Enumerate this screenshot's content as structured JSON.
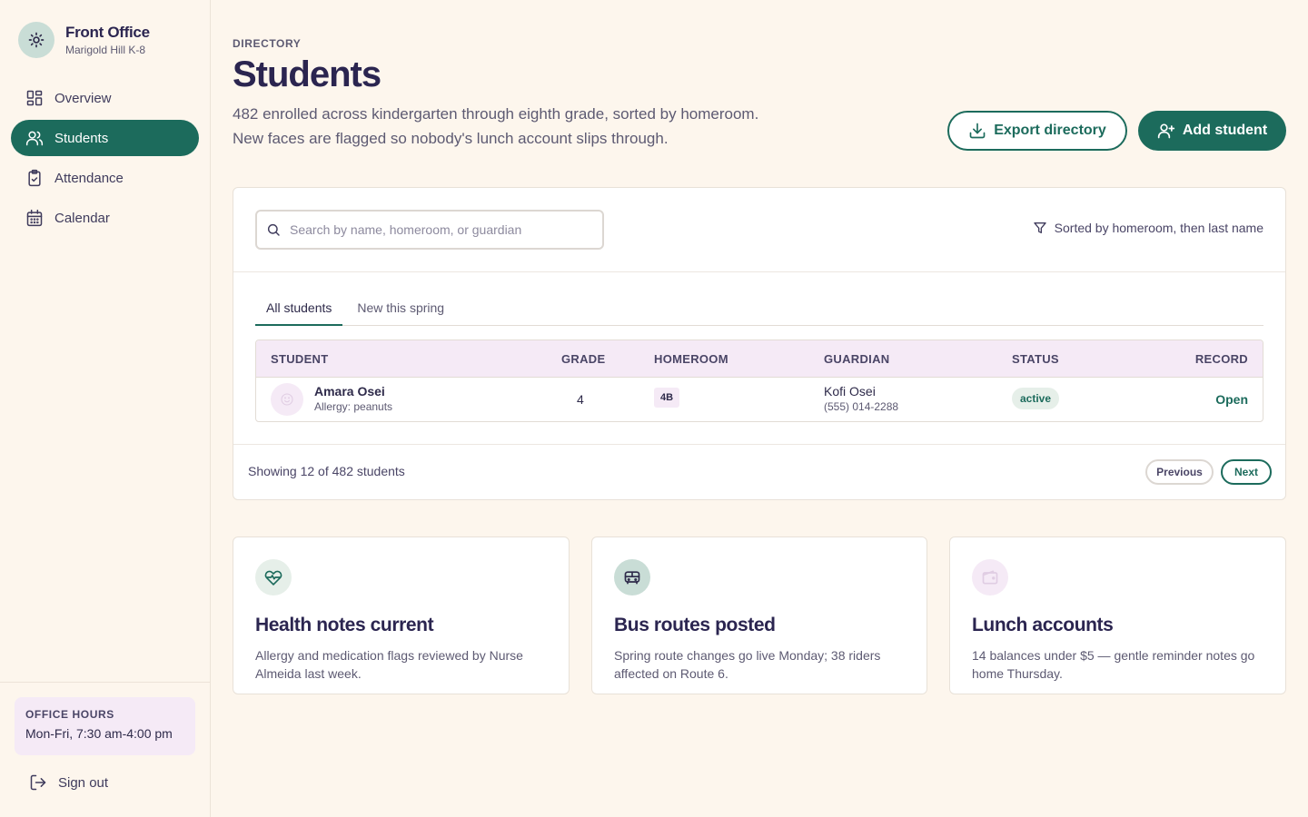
{
  "brand": {
    "title": "Front Office",
    "subtitle": "Marigold Hill K-8",
    "icon": "sun-icon"
  },
  "nav": [
    {
      "label": "Overview",
      "icon": "grid-icon",
      "active": false
    },
    {
      "label": "Students",
      "icon": "users-icon",
      "active": true
    },
    {
      "label": "Attendance",
      "icon": "clipboard-check-icon",
      "active": false
    },
    {
      "label": "Calendar",
      "icon": "calendar-icon",
      "active": false
    }
  ],
  "office_hours": {
    "label": "OFFICE HOURS",
    "value": "Mon-Fri, 7:30 am-4:00 pm"
  },
  "signout": {
    "label": "Sign out",
    "icon": "logout-icon"
  },
  "header": {
    "eyebrow": "DIRECTORY",
    "title": "Students",
    "description": "482 enrolled across kindergarten through eighth grade, sorted by homeroom. New faces are flagged so nobody's lunch account slips through.",
    "export_label": "Export directory",
    "add_label": "Add student"
  },
  "search": {
    "placeholder": "Search by name, homeroom, or guardian",
    "value": ""
  },
  "sort_info": "Sorted by homeroom, then last name",
  "tabs": [
    {
      "label": "All students",
      "active": true
    },
    {
      "label": "New this spring",
      "active": false
    }
  ],
  "table": {
    "columns": [
      "STUDENT",
      "GRADE",
      "HOMEROOM",
      "GUARDIAN",
      "STATUS",
      "RECORD"
    ],
    "rows": [
      {
        "name": "Amara Osei",
        "note": "Allergy: peanuts",
        "grade": "4",
        "homeroom": "4B",
        "guardian": "Kofi Osei",
        "guardian_phone": "(555) 014-2288",
        "status": "active",
        "record": "Open"
      }
    ]
  },
  "pagination": {
    "summary": "Showing 12 of 482 students",
    "prev": "Previous",
    "next": "Next"
  },
  "info_cards": [
    {
      "title": "Health notes current",
      "body": "Allergy and medication flags reviewed by Nurse Almeida last week.",
      "icon": "heart-pulse-icon",
      "icon_bg": "#e6efe9"
    },
    {
      "title": "Bus routes posted",
      "body": "Spring route changes go live Monday; 38 riders affected on Route 6.",
      "icon": "bus-icon",
      "icon_bg": "#c9ddd6"
    },
    {
      "title": "Lunch accounts",
      "body": "14 balances under $5 — gentle reminder notes go home Thursday.",
      "icon": "wallet-icon",
      "icon_bg": "#f5eaf6"
    }
  ],
  "colors": {
    "accent": "#1c6b5c",
    "background": "#fdf6ed",
    "lavender": "#f5eaf6",
    "heading": "#2b2550"
  }
}
